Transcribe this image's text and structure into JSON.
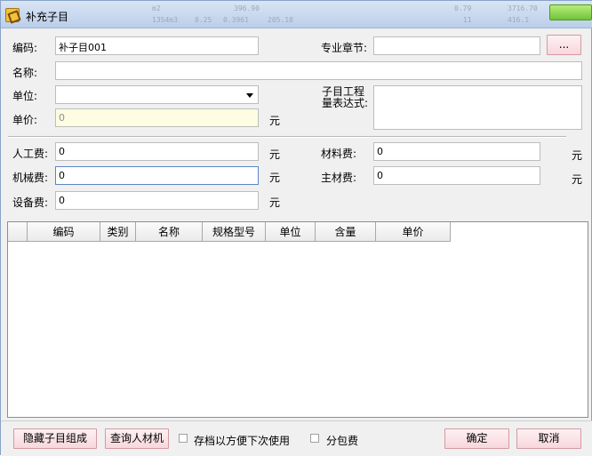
{
  "window": {
    "title": "补充子目"
  },
  "titlebar_ghost": [
    "m2",
    "396.90",
    "0.79",
    "3716.70",
    "1354m3",
    "0.25",
    "0.3961",
    "205.10",
    "11",
    "416.1"
  ],
  "form": {
    "code_label": "编码:",
    "code_value": "补子目001",
    "chapter_label": "专业章节:",
    "chapter_value": "",
    "browse_label": "...",
    "name_label": "名称:",
    "name_value": "",
    "unit_label": "单位:",
    "unit_value": "",
    "expr_label": "子目工程\n量表达式:",
    "expr_value": "",
    "price_label": "单价:",
    "price_value": "0",
    "yuan": "元",
    "labor_label": "人工费:",
    "labor_value": "0",
    "material_label": "材料费:",
    "material_value": "0",
    "machine_label": "机械费:",
    "machine_value": "0",
    "main_material_label": "主材费:",
    "main_material_value": "0",
    "equipment_label": "设备费:",
    "equipment_value": "0"
  },
  "grid": {
    "columns": [
      "",
      "编码",
      "类别",
      "名称",
      "规格型号",
      "单位",
      "含量",
      "单价"
    ]
  },
  "bottom": {
    "hide_button": "隐藏子目组成",
    "query_button": "查询人材机",
    "save_check_label": "存档以方便下次使用",
    "save_checked": false,
    "subcontract_label": "分包费",
    "subcontract_checked": false,
    "ok_button": "确定",
    "cancel_button": "取消"
  }
}
